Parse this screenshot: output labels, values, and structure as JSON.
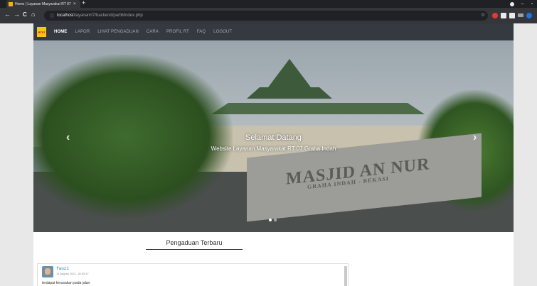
{
  "browser": {
    "tab_title": "Home | Layanan Masyarakat RT 07",
    "tab_close": "×",
    "new_tab": "+",
    "url_host": "localhost",
    "url_path": "/layananrt7/backend/part6/index.php",
    "back": "←",
    "forward": "→",
    "reload": "C",
    "home": "⌂",
    "info": "ⓘ",
    "star": "☆",
    "minimize": "–"
  },
  "nav": {
    "logo_text": "RT07",
    "items": [
      "HOME",
      "LAPOR",
      "LIHAT PENGADUAN",
      "CARA",
      "PROFIL RT",
      "FAQ",
      "LOGOUT"
    ]
  },
  "carousel": {
    "title": "Selamat Datang",
    "subtitle": "Website Layanan Masyarakat RT 07 Graha Indah",
    "sign_line1": "MASJID AN NUR",
    "sign_line2": "GRAHA INDAH - BEKASI",
    "prev_icon": "‹",
    "next_icon": "›"
  },
  "section": {
    "title": "Pengaduan Terbaru"
  },
  "complaint": {
    "name": "fauzi",
    "date": "14 August 2021, 16:33:17",
    "text": "terdapat kerusakan pada jalan"
  }
}
